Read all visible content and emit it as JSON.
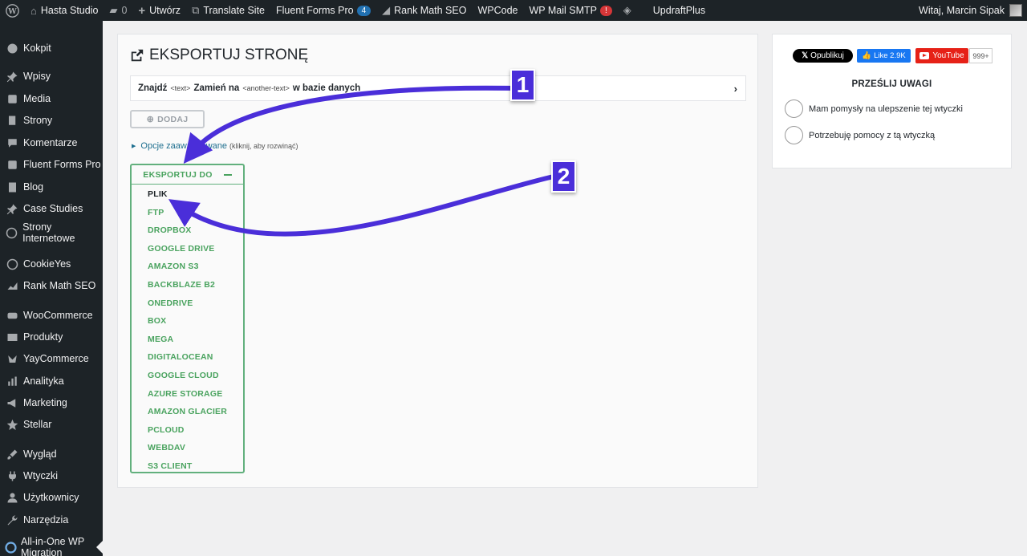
{
  "adminbar": {
    "site_name": "Hasta Studio",
    "comments_count": "0",
    "new_label": "Utwórz",
    "translate_label": "Translate Site",
    "fluent_label": "Fluent Forms Pro",
    "fluent_badge": "4",
    "rankmath_label": "Rank Math SEO",
    "wpcode_label": "WPCode",
    "smtp_label": "WP Mail SMTP",
    "smtp_badge": "!",
    "updraft_label": "UpdraftPlus",
    "greeting": "Witaj, Marcin Sipak"
  },
  "sidebar": {
    "items": [
      {
        "label": "Kokpit",
        "icon": "dashboard-icon"
      },
      {
        "label": "Wpisy",
        "icon": "pin-icon"
      },
      {
        "label": "Media",
        "icon": "media-icon"
      },
      {
        "label": "Strony",
        "icon": "pages-icon"
      },
      {
        "label": "Komentarze",
        "icon": "comments-icon"
      },
      {
        "label": "Fluent Forms Pro",
        "icon": "forms-icon"
      },
      {
        "label": "Blog",
        "icon": "blog-icon"
      },
      {
        "label": "Case Studies",
        "icon": "pin-icon"
      },
      {
        "label": "Strony Internetowe",
        "icon": "globe-icon"
      },
      {
        "label": "CookieYes",
        "icon": "cookie-icon"
      },
      {
        "label": "Rank Math SEO",
        "icon": "chart-icon"
      },
      {
        "label": "WooCommerce",
        "icon": "woo-icon"
      },
      {
        "label": "Produkty",
        "icon": "archive-icon"
      },
      {
        "label": "YayCommerce",
        "icon": "yay-icon"
      },
      {
        "label": "Analityka",
        "icon": "bars-icon"
      },
      {
        "label": "Marketing",
        "icon": "megaphone-icon"
      },
      {
        "label": "Stellar",
        "icon": "star-icon"
      },
      {
        "label": "Wygląd",
        "icon": "brush-icon"
      },
      {
        "label": "Wtyczki",
        "icon": "plugin-icon"
      },
      {
        "label": "Użytkownicy",
        "icon": "user-icon"
      },
      {
        "label": "Narzędzia",
        "icon": "wrench-icon"
      },
      {
        "label": "All-in-One WP Migration",
        "icon": "migration-icon"
      }
    ]
  },
  "main": {
    "title": "EKSPORTUJ STRONĘ",
    "find": {
      "find_label": "Znajdź",
      "find_placeholder": "<text>",
      "replace_label": "Zamień na",
      "replace_placeholder": "<another-text>",
      "suffix": "w bazie danych"
    },
    "add_button": "DODAJ",
    "advanced_options": "Opcje zaawansowane",
    "advanced_hint": "(kliknij, aby rozwinąć)",
    "export_to": "EKSPORTUJ DO",
    "export_targets": [
      "PLIK",
      "FTP",
      "DROPBOX",
      "GOOGLE DRIVE",
      "AMAZON S3",
      "BACKBLAZE B2",
      "ONEDRIVE",
      "BOX",
      "MEGA",
      "DIGITALOCEAN",
      "GOOGLE CLOUD",
      "AZURE STORAGE",
      "AMAZON GLACIER",
      "PCLOUD",
      "WEBDAV",
      "S3 CLIENT"
    ]
  },
  "side": {
    "twitter_label": "Opublikuj",
    "facebook_label": "Like 2.9K",
    "youtube_label": "YouTube",
    "youtube_count": "999+",
    "feedback_title": "PRZEŚLIJ UWAGI",
    "options": [
      "Mam pomysły na ulepszenie tej wtyczki",
      "Potrzebuję pomocy z tą wtyczką"
    ]
  },
  "annotations": {
    "badge_1": "1",
    "badge_2": "2",
    "arrow_color": "#4a2ed9"
  }
}
